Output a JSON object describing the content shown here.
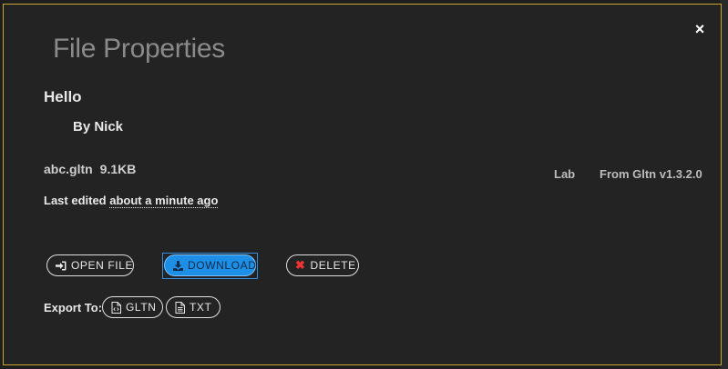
{
  "dialog": {
    "title": "File Properties",
    "close_glyph": "×"
  },
  "file": {
    "name": "Hello",
    "author": "By Nick",
    "filename": "abc.gltn",
    "size": "9.1KB",
    "category": "Lab",
    "version": "From Gltn v1.3.2.0",
    "edited_prefix": "Last edited",
    "edited_when": "about a minute ago"
  },
  "actions": {
    "open_label": "OPEN FILE",
    "download_label": "DOWNLOAD",
    "delete_label": "DELETE",
    "delete_glyph": "✖"
  },
  "export": {
    "label": "Export To:",
    "gltn_label": "GLTN",
    "txt_label": "TXT"
  },
  "icons": {
    "open": "sign-in-icon",
    "download": "download-icon",
    "delete": "times-icon",
    "gltn": "code-file-icon",
    "txt": "text-file-icon",
    "close": "close-icon"
  },
  "colors": {
    "dialog_bg": "#232323",
    "dialog_border": "#c8a62a",
    "download_bg": "#1e8fe6",
    "delete_icon": "#e33333"
  }
}
